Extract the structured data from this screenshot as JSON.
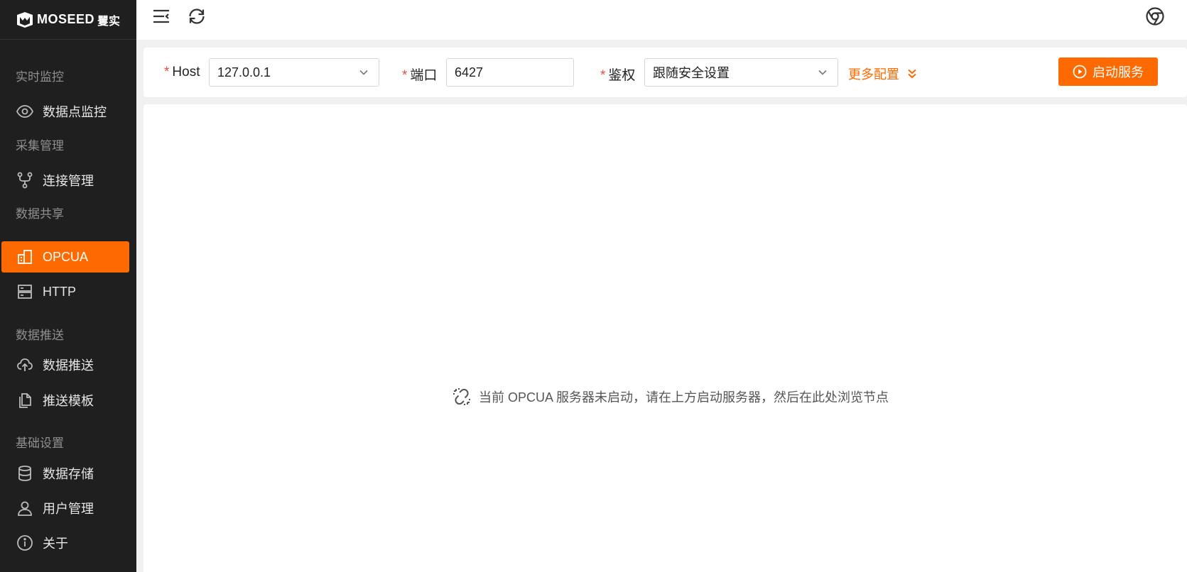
{
  "app": {
    "brand": "MOSEED",
    "brand_cn": "矍实"
  },
  "sidebar": {
    "groups": [
      {
        "title": "实时监控",
        "items": [
          {
            "label": "数据点监控",
            "icon": "eye-icon"
          }
        ]
      },
      {
        "title": "采集管理",
        "items": [
          {
            "label": "连接管理",
            "icon": "branch-icon"
          }
        ]
      },
      {
        "title": "数据共享",
        "items": [
          {
            "label": "OPCUA",
            "icon": "opcua-icon",
            "active": true
          },
          {
            "label": "HTTP",
            "icon": "server-icon"
          }
        ]
      },
      {
        "title": "数据推送",
        "items": [
          {
            "label": "数据推送",
            "icon": "cloud-upload-icon"
          },
          {
            "label": "推送模板",
            "icon": "copy-icon"
          }
        ]
      },
      {
        "title": "基础设置",
        "items": [
          {
            "label": "数据存储",
            "icon": "database-icon"
          },
          {
            "label": "用户管理",
            "icon": "user-icon"
          },
          {
            "label": "关于",
            "icon": "info-icon"
          }
        ]
      }
    ]
  },
  "topbar": {
    "menu_icon": "menu-collapse-icon",
    "refresh_icon": "refresh-icon",
    "browser_icon": "chrome-icon"
  },
  "config": {
    "host_label": "Host",
    "host_value": "127.0.0.1",
    "port_label": "端口",
    "port_value": "6427",
    "auth_label": "鉴权",
    "auth_value": "跟随安全设置",
    "required_mark": "*",
    "more_label": "更多配置",
    "start_label": "启动服务"
  },
  "main": {
    "empty_message": "当前 OPCUA 服务器未启动，请在上方启动服务器，然后在此处浏览节点"
  },
  "colors": {
    "accent": "#ff6a00",
    "sidebar_bg": "#1f1f1f",
    "required": "#e54d42"
  }
}
